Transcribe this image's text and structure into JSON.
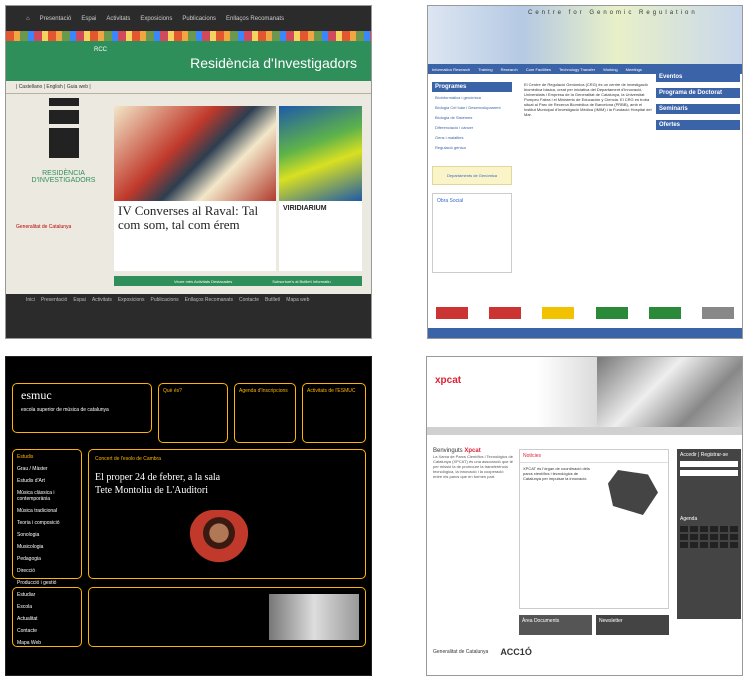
{
  "p1": {
    "topnav": [
      "Presentació",
      "Espai",
      "Activitats",
      "Exposicions",
      "Publicacions",
      "Enllaços Recomanats"
    ],
    "rcc": "RCC",
    "title": "Residència d'Investigadors",
    "sub": "| Castellano | English | Guia web |",
    "logo_text": "RESIDÈNCIA D'INVESTIGADORS",
    "gencat": "Generalitat de Catalunya",
    "card1": {
      "title": "IV Converses al Raval: Tal com som, tal com érem"
    },
    "card2": {
      "title": "VIRIDIARIUM"
    },
    "links": [
      "Veure més Activitats Destacades",
      "Subscriure's al Butlletí Informatiu"
    ],
    "footer_nav": [
      "Inici",
      "Presentació",
      "Espai",
      "Activitats",
      "Exposicions",
      "Publicacions",
      "Enllaços Recomanats",
      "Contacte",
      "Butlletí",
      "Mapa web"
    ]
  },
  "p2": {
    "header": "Centre for Genomic Regulation",
    "menu": [
      "Information Research",
      "Training",
      "Research",
      "Core Facilities",
      "Technology Transfer",
      "Working",
      "Meetings"
    ],
    "left_title": "Programes",
    "left_items": [
      "Bioinformàtica i genòmica",
      "Biologia Cel·lular i Desenvolupament",
      "Biologia de Sistemes",
      "Diferenciació i càncer",
      "Gens i malalties",
      "Regulació gènica"
    ],
    "yellow": "Departaments de Genòmica",
    "obra": "Obra Social",
    "center": "El Centre de Regulació Genòmica (CRG) és un centre de investigació biomèdica bàsica, creat per iniciativa del Departament d'Innovació, Universitats i Empresa de la Generalitat de Catalunya, la Universitat Pompeu Fabra i el Ministerio de Educación y Ciencia. El CRG es troba situat al Parc de Recerca Biomèdica de Barcelona (PRBB), amb el Institut Municipal d'Investigació Mèdica (IMIM) i la Fundació Hospital del Mar.",
    "right_titles": [
      "Eventos",
      "Programa de Doctorat",
      "Seminaris",
      "Ofertes"
    ]
  },
  "p3": {
    "logo": "esmuc",
    "logo_sub": "escola superior de música de catalunya",
    "boxes": [
      "Què és?",
      "Agenda d'Inscripcions",
      "Activitats de l'ESMUC"
    ],
    "menu_title": "Estudis",
    "menu": [
      "Grau / Màster",
      "Estudis d'Art",
      "Música clàssica i contemporània",
      "Música tradicional",
      "Teoria i composició",
      "Sonologia",
      "Musicologia",
      "Pedagogia",
      "Direcció",
      "Producció i gestió"
    ],
    "concert": "Concert de l'esolo de Cambra",
    "big": "El proper 24 de febrer, a la sala Tete Montoliu de L'Auditori",
    "bottom_menu": [
      "Estudiar",
      "Escola",
      "Actualitat",
      "Contacte",
      "Mapa Web"
    ]
  },
  "p4": {
    "xpcat": "xpcat",
    "left_h1": "Benvinguts",
    "left_h2": "Xpcat",
    "left_body": "La Xarxa de Parcs Científics i Tecnològics de Catalunya (XPCAT) és una associació que té per missió la de promoure la transferència tecnològica, la innovació i la cooperació entre els parcs que en formen part.",
    "center_head": "Notícies",
    "center_body": "XPCAT és l'òrgan de coordinació dels parcs científics i tecnològics de Catalunya per impulsar la innovació.",
    "right": [
      "Accedir | Registrar-se",
      "Agenda"
    ],
    "mid": [
      "Àrea Documents",
      "Newsletter"
    ],
    "foot": [
      "Generalitat de Catalunya",
      "ACC1Ó"
    ]
  }
}
